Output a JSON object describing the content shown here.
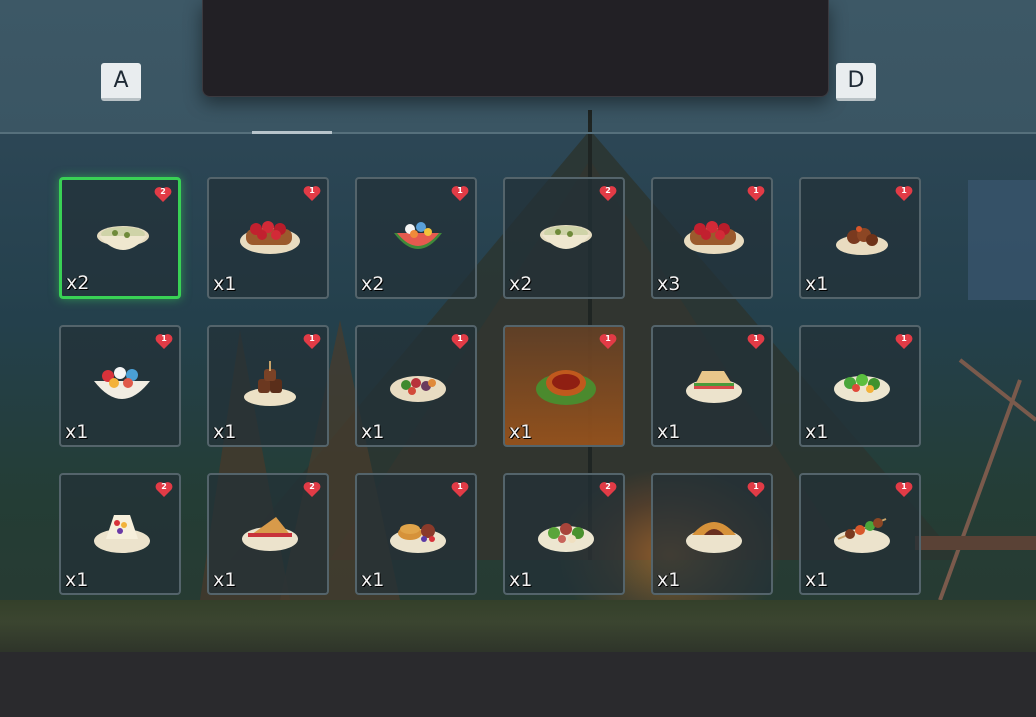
{
  "controls": {
    "prev_key": "A",
    "next_key": "D"
  },
  "inventory": {
    "items": [
      {
        "icon": "soup-bowl-icon",
        "qty": "x2",
        "heart": "2",
        "selected": true
      },
      {
        "icon": "berry-toast-icon",
        "qty": "x1",
        "heart": "1"
      },
      {
        "icon": "fruit-watermelon-bowl-icon",
        "qty": "x2",
        "heart": "1"
      },
      {
        "icon": "soup-bowl-icon",
        "qty": "x2",
        "heart": "2"
      },
      {
        "icon": "berry-toast-icon",
        "qty": "x3",
        "heart": "1"
      },
      {
        "icon": "roast-plate-icon",
        "qty": "x1",
        "heart": "1"
      },
      {
        "icon": "fruit-salad-bowl-icon",
        "qty": "x1",
        "heart": "1"
      },
      {
        "icon": "meat-stack-icon",
        "qty": "x1",
        "heart": "1"
      },
      {
        "icon": "vegetable-salad-icon",
        "qty": "x1",
        "heart": "1"
      },
      {
        "icon": "tart-on-leaf-icon",
        "qty": "x1",
        "heart": "1",
        "highlighted": true
      },
      {
        "icon": "sandwich-icon",
        "qty": "x1",
        "heart": "1"
      },
      {
        "icon": "green-salad-icon",
        "qty": "x1",
        "heart": "1"
      },
      {
        "icon": "fruit-sandwich-icon",
        "qty": "x1",
        "heart": "2"
      },
      {
        "icon": "toasted-sandwich-icon",
        "qty": "x1",
        "heart": "2"
      },
      {
        "icon": "pancake-breakfast-icon",
        "qty": "x1",
        "heart": "1"
      },
      {
        "icon": "meat-salad-icon",
        "qty": "x1",
        "heart": "2"
      },
      {
        "icon": "pie-icon",
        "qty": "x1",
        "heart": "1"
      },
      {
        "icon": "kebab-icon",
        "qty": "x1",
        "heart": "1"
      }
    ]
  },
  "colors": {
    "selected_border": "#39d155",
    "heart": "#e23b46",
    "highlight_slot": "#a05a1e"
  }
}
